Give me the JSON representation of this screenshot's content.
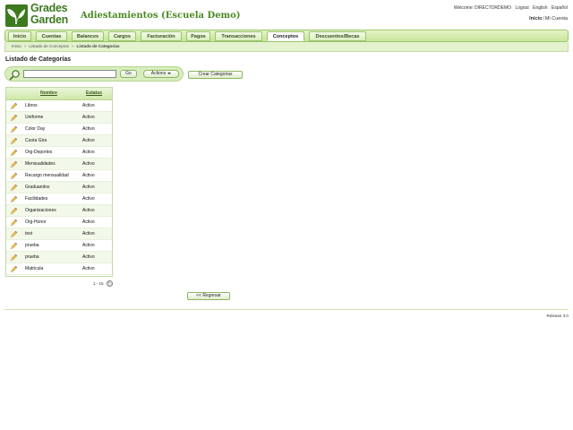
{
  "header": {
    "logo_line1": "Grades",
    "logo_line2": "Garden",
    "app_title": "Adiestamientos (Escuela Demo)",
    "welcome_prefix": "Welcome:",
    "username": "DIRECTORDEMO",
    "logout": "Logout",
    "english": "English",
    "espanol": "Español",
    "inicio": "Inicio",
    "sep": "|",
    "mi_cuenta": "Mi Cuenta"
  },
  "nav": {
    "tabs": [
      {
        "label": "Inicio"
      },
      {
        "label": "Cuentas"
      },
      {
        "label": "Balances"
      },
      {
        "label": "Cargos"
      },
      {
        "label": "Facturación"
      },
      {
        "label": "Pagos"
      },
      {
        "label": "Transacciones"
      },
      {
        "label": "Conceptos",
        "active": true
      },
      {
        "label": "Descuentos/Becas"
      }
    ]
  },
  "breadcrumb": {
    "items": [
      "Inicio",
      "Listado de Conceptos",
      "Listado de Categorías"
    ],
    "separator": ">"
  },
  "page": {
    "title": "Listado de Categorías",
    "search_value": "",
    "go_label": "Go",
    "actions_label": "Actions",
    "crear_label": "Crear Categorias",
    "regresar_label": "<< Regresar"
  },
  "table": {
    "columns": [
      "Nombre",
      "Estatus"
    ],
    "rows": [
      {
        "nombre": "Libros",
        "estatus": "Activo"
      },
      {
        "nombre": "Uniforme",
        "estatus": "Activo"
      },
      {
        "nombre": "Color Day",
        "estatus": "Activo"
      },
      {
        "nombre": "Cuota Gira",
        "estatus": "Activo"
      },
      {
        "nombre": "Org-Deportes",
        "estatus": "Activo"
      },
      {
        "nombre": "Mensualidades",
        "estatus": "Activo"
      },
      {
        "nombre": "Recargo mensualidad",
        "estatus": "Activo"
      },
      {
        "nombre": "Graduandos",
        "estatus": "Activo"
      },
      {
        "nombre": "Facilidades",
        "estatus": "Activo"
      },
      {
        "nombre": "Organizaciones",
        "estatus": "Activo"
      },
      {
        "nombre": "Org-Honor",
        "estatus": "Activo"
      },
      {
        "nombre": "test",
        "estatus": "Activo"
      },
      {
        "nombre": "prueba",
        "estatus": "Activo"
      },
      {
        "nombre": "prueba",
        "estatus": "Activo"
      },
      {
        "nombre": "Matricula",
        "estatus": "Activo"
      }
    ]
  },
  "pager": {
    "text": "1 - 15",
    "next_glyph": "›"
  },
  "footer": {
    "release": "Release 3.0"
  },
  "colors": {
    "brand_green": "#3d7a1f",
    "title_green": "#4a8a22",
    "nav_bg": "#c6e59a"
  },
  "icons": {
    "row_action": "pencil-icon",
    "search": "magnifier-icon",
    "logo": "leaf-icon"
  }
}
